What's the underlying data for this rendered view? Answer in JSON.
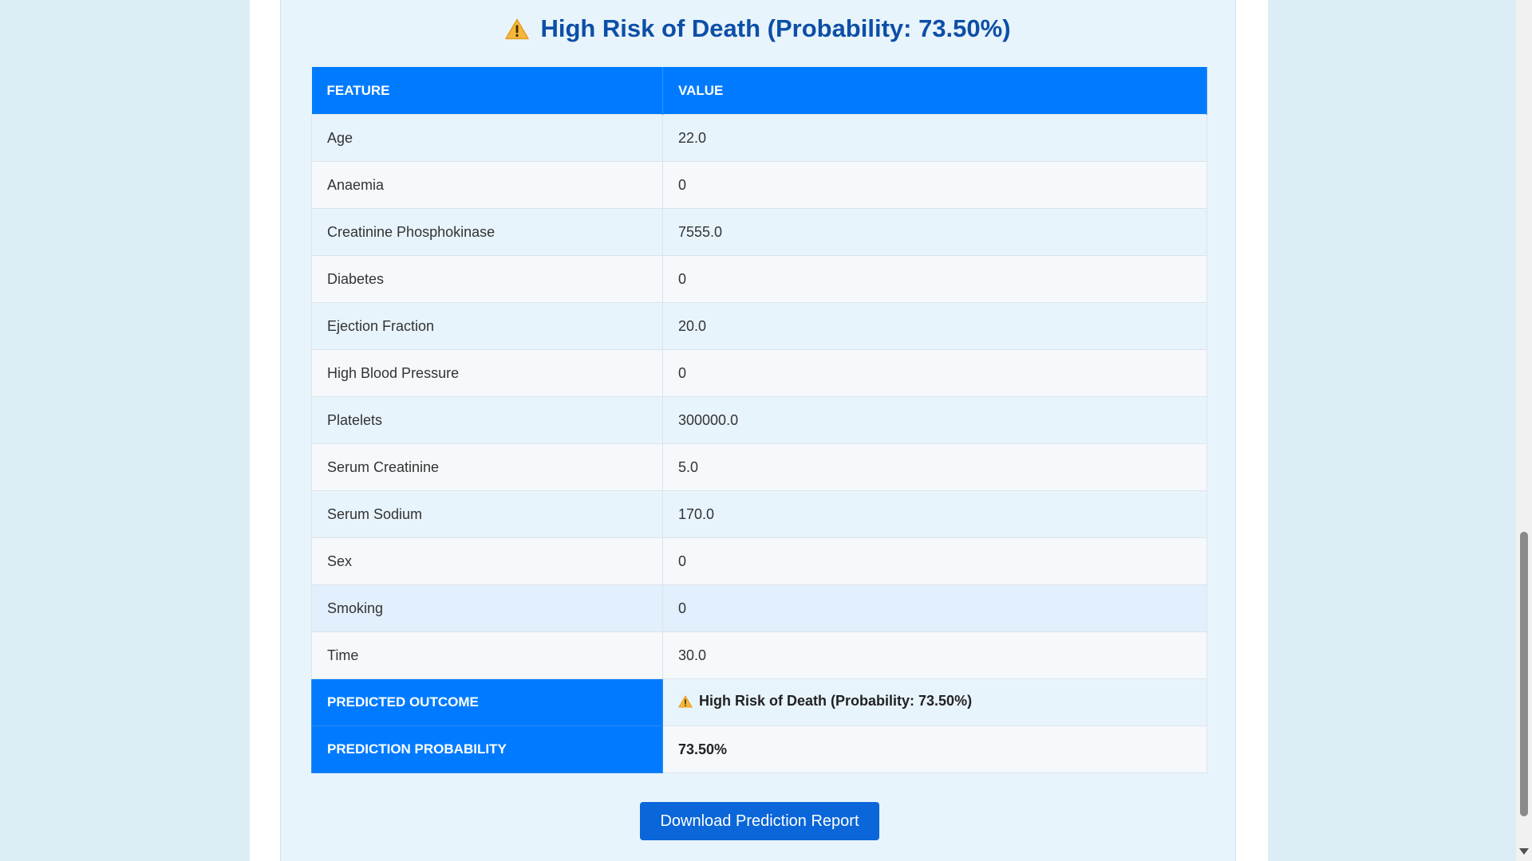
{
  "result": {
    "heading": "High Risk of Death (Probability: 73.50%)",
    "icon": "warning-icon"
  },
  "table": {
    "headers": [
      "FEATURE",
      "VALUE"
    ],
    "rows": [
      {
        "feature": "Age",
        "value": "22.0"
      },
      {
        "feature": "Anaemia",
        "value": "0"
      },
      {
        "feature": "Creatinine Phosphokinase",
        "value": "7555.0"
      },
      {
        "feature": "Diabetes",
        "value": "0"
      },
      {
        "feature": "Ejection Fraction",
        "value": "20.0"
      },
      {
        "feature": "High Blood Pressure",
        "value": "0"
      },
      {
        "feature": "Platelets",
        "value": "300000.0"
      },
      {
        "feature": "Serum Creatinine",
        "value": "5.0"
      },
      {
        "feature": "Serum Sodium",
        "value": "170.0"
      },
      {
        "feature": "Sex",
        "value": "0"
      },
      {
        "feature": "Smoking",
        "value": "0"
      },
      {
        "feature": "Time",
        "value": "30.0"
      }
    ],
    "summary": {
      "outcome_label": "PREDICTED OUTCOME",
      "outcome_value": "High Risk of Death (Probability: 73.50%)",
      "probability_label": "PREDICTION PROBABILITY",
      "probability_value": "73.50%"
    }
  },
  "download": {
    "label": "Download Prediction Report"
  },
  "colors": {
    "header_blue": "#007bff",
    "heading_text": "#0d4fa6",
    "button_blue": "#0a66d9",
    "page_bg": "#dcedf6",
    "card_bg": "#e8f4fc",
    "warning_yellow": "#f5b73b"
  }
}
